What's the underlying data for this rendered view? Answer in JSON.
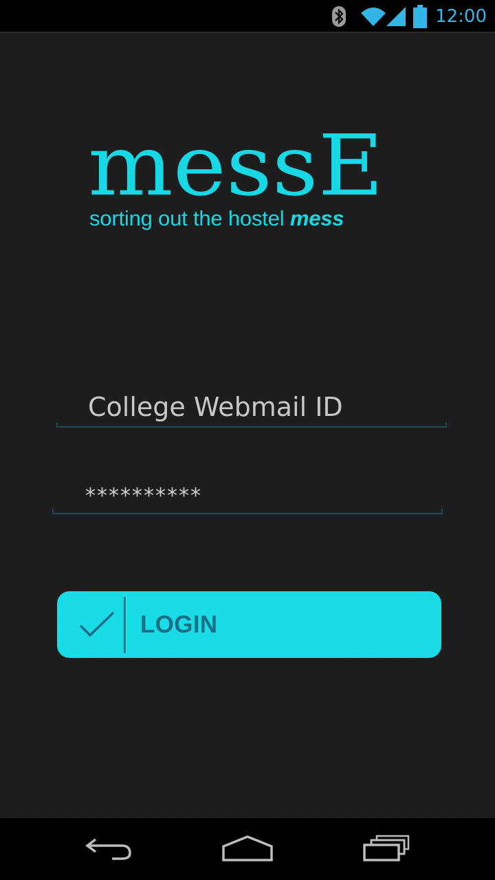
{
  "status_bar": {
    "time": "12:00",
    "icons": [
      "bluetooth-icon",
      "wifi-icon",
      "cell-signal-icon",
      "battery-icon"
    ],
    "accent_color": "#33b5e5"
  },
  "logo": {
    "brand_name": "messE",
    "tagline_prefix": "sorting out the hostel",
    "tagline_emphasis": "mess",
    "brand_color": "#19d8e6"
  },
  "form": {
    "email_placeholder": "College Webmail ID",
    "email_value": "",
    "password_value": "**********"
  },
  "login_button": {
    "label": "LOGIN",
    "icon": "checkmark-icon",
    "background_color": "#1adce6",
    "label_color": "#1a6f86"
  },
  "nav_bar": {
    "icons": [
      "back-icon",
      "home-icon",
      "recents-icon"
    ]
  }
}
